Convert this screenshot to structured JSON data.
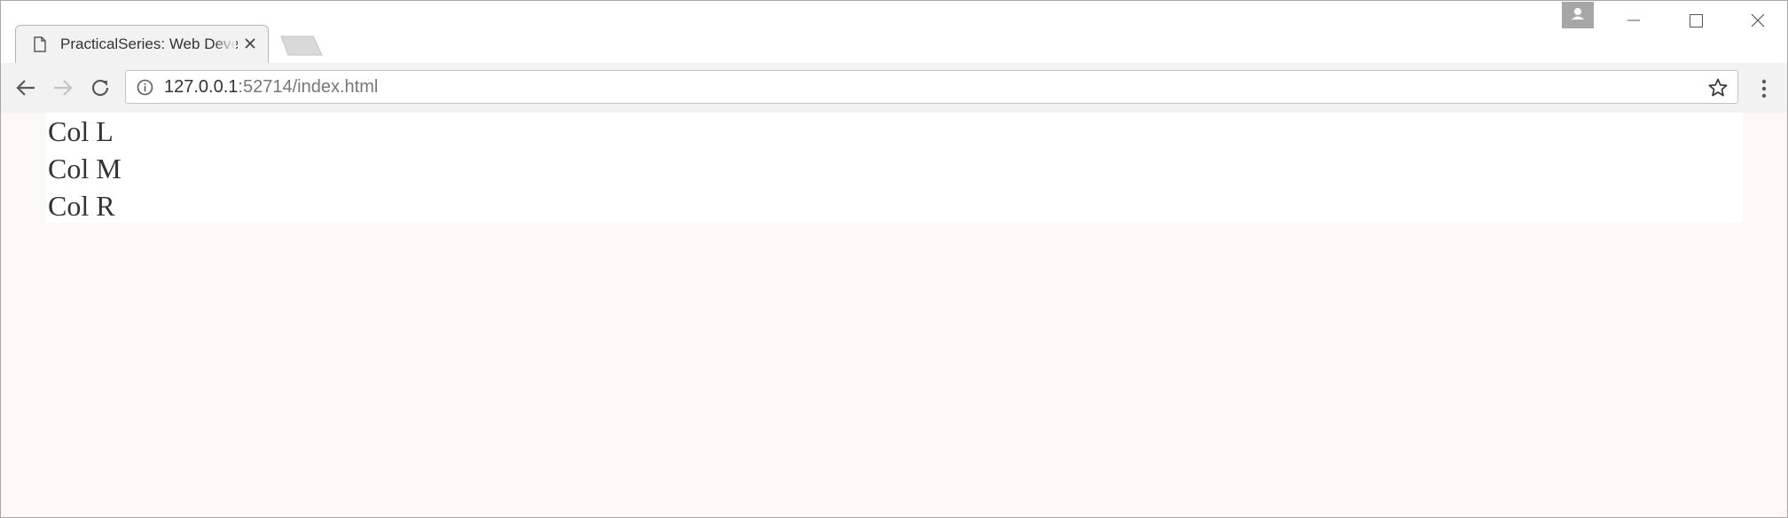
{
  "browser": {
    "tab_title": "PracticalSeries: Web Development",
    "url_host": "127.0.0.1",
    "url_rest": ":52714/index.html"
  },
  "page": {
    "columns": [
      "Col L",
      "Col M",
      "Col R"
    ]
  },
  "colors": {
    "page_background": "#faf9f6",
    "content_background": "#ffffff",
    "text": "#333333"
  }
}
